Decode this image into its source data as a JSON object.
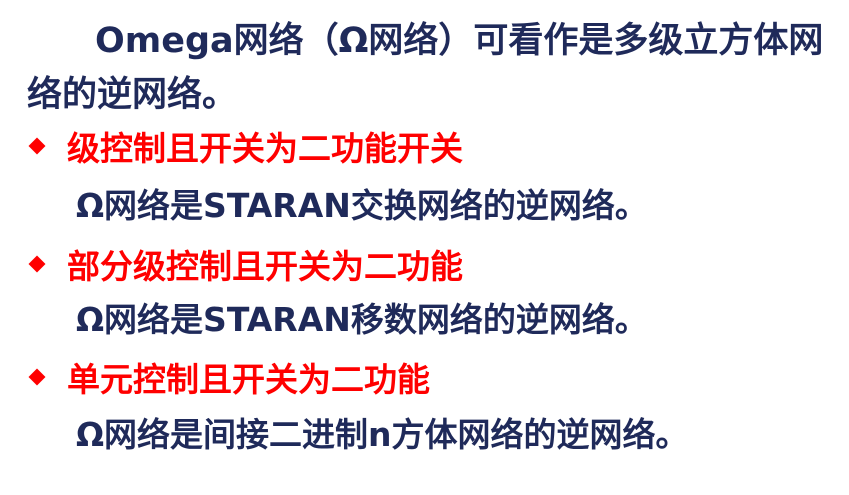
{
  "intro": "Omega网络（Ω网络）可看作是多级立方体网络的逆网络。",
  "items": [
    {
      "bullet": "级控制且开关为二功能开关",
      "detail": "Ω网络是STARAN交换网络的逆网络。"
    },
    {
      "bullet": "部分级控制且开关为二功能",
      "detail": "Ω网络是STARAN移数网络的逆网络。"
    },
    {
      "bullet": "单元控制且开关为二功能",
      "detail": "Ω网络是间接二进制n方体网络的逆网络。"
    }
  ],
  "colors": {
    "bullet": "#ff0000",
    "text": "#1f2a5a"
  }
}
